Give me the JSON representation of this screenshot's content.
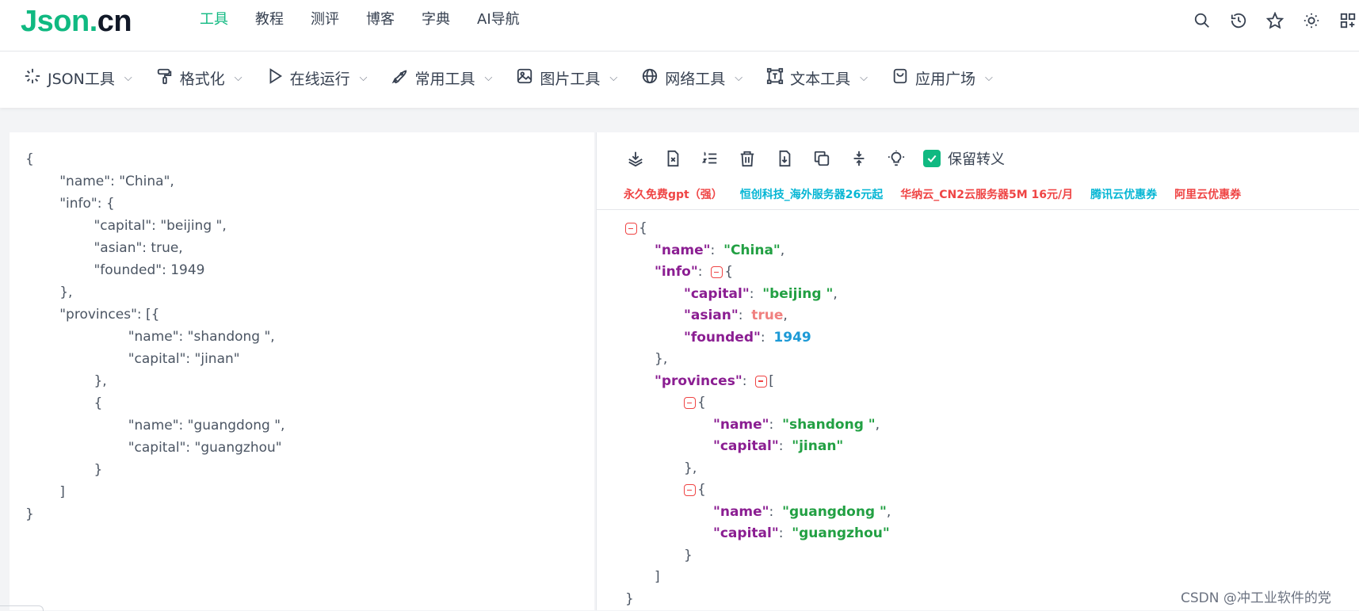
{
  "logo": {
    "part1": "Json.",
    "part2": "cn"
  },
  "nav": [
    {
      "label": "工具",
      "active": true
    },
    {
      "label": "教程",
      "active": false
    },
    {
      "label": "测评",
      "active": false
    },
    {
      "label": "博客",
      "active": false
    },
    {
      "label": "字典",
      "active": false
    },
    {
      "label": "AI导航",
      "active": false
    }
  ],
  "top_icons": [
    "search-icon",
    "history-icon",
    "star-icon",
    "sun-icon",
    "apps-icon"
  ],
  "toolbar": [
    {
      "label": "JSON工具",
      "icon": "sparkle-icon"
    },
    {
      "label": "格式化",
      "icon": "paint-roller-icon"
    },
    {
      "label": "在线运行",
      "icon": "play-icon"
    },
    {
      "label": "常用工具",
      "icon": "rocket-icon"
    },
    {
      "label": "图片工具",
      "icon": "image-icon"
    },
    {
      "label": "网络工具",
      "icon": "globe-icon"
    },
    {
      "label": "文本工具",
      "icon": "text-frame-icon"
    },
    {
      "label": "应用广场",
      "icon": "shopping-bag-icon"
    }
  ],
  "input_lines": [
    "{",
    "        \"name\": \"China\",",
    "        \"info\": {",
    "                \"capital\": \"beijing \",",
    "                \"asian\": true,",
    "                \"founded\": 1949",
    "        },",
    "        \"provinces\": [{",
    "                        \"name\": \"shandong \",",
    "                        \"capital\": \"jinan\"",
    "                },",
    "                {",
    "                        \"name\": \"guangdong \",",
    "                        \"capital\": \"guangzhou\"",
    "                }",
    "        ]",
    "}"
  ],
  "output_actions": [
    "layers-icon",
    "clear-file-icon",
    "numbered-list-icon",
    "trash-icon",
    "download-icon",
    "copy-icon",
    "compress-icon",
    "bulb-icon"
  ],
  "keep_escape": {
    "label": "保留转义",
    "checked": true
  },
  "ads": [
    {
      "text": "永久免费gpt（强）",
      "color": "red"
    },
    {
      "text": "恒创科技_海外服务器26元起",
      "color": "cyan"
    },
    {
      "text": "华纳云_CN2云服务器5M 16元/月",
      "color": "red"
    },
    {
      "text": "腾讯云优惠券",
      "color": "cyan"
    },
    {
      "text": "阿里云优惠券",
      "color": "red"
    }
  ],
  "tree": {
    "name_key": "\"name\"",
    "name_val": "\"China\"",
    "info_key": "\"info\"",
    "capital_key": "\"capital\"",
    "capital_val": "\"beijing \"",
    "asian_key": "\"asian\"",
    "asian_val": "true",
    "founded_key": "\"founded\"",
    "founded_val": "1949",
    "provinces_key": "\"provinces\"",
    "p1_name_key": "\"name\"",
    "p1_name_val": "\"shandong \"",
    "p1_capital_key": "\"capital\"",
    "p1_capital_val": "\"jinan\"",
    "p2_name_key": "\"name\"",
    "p2_name_val": "\"guangdong \"",
    "p2_capital_key": "\"capital\"",
    "p2_capital_val": "\"guangzhou\""
  },
  "watermark": "CSDN @冲工业软件的党",
  "colors": {
    "accent": "#10b981",
    "key": "#8b1e92",
    "string": "#22a043",
    "boolean": "#f0807f",
    "number": "#1d9ad6",
    "toggle": "#ef4444"
  }
}
